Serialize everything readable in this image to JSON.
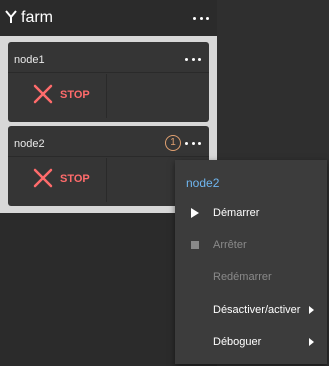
{
  "farm": {
    "title": "farm",
    "icon": "fork-icon"
  },
  "nodes": [
    {
      "name": "node1",
      "status": "STOP",
      "badge": null
    },
    {
      "name": "node2",
      "status": "STOP",
      "badge": "1"
    }
  ],
  "context_menu": {
    "title": "node2",
    "items": [
      {
        "label": "Démarrer",
        "icon": "play-icon",
        "disabled": false,
        "submenu": false
      },
      {
        "label": "Arrêter",
        "icon": "stop-square-icon",
        "disabled": true,
        "submenu": false
      },
      {
        "label": "Redémarrer",
        "icon": null,
        "disabled": true,
        "submenu": false
      },
      {
        "label": "Désactiver/activer",
        "icon": null,
        "disabled": false,
        "submenu": true
      },
      {
        "label": "Déboguer",
        "icon": null,
        "disabled": false,
        "submenu": true
      }
    ]
  },
  "colors": {
    "stop": "#ff6b6b",
    "badge": "#e0a070",
    "menu_title": "#6fb6f0"
  }
}
